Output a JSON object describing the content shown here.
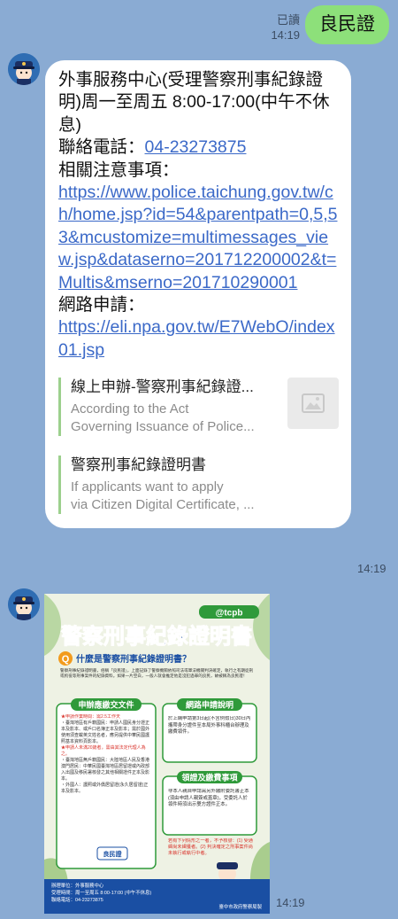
{
  "sent": {
    "read_label": "已讀",
    "time": "14:19",
    "text": "良民證"
  },
  "reply": {
    "line1": "外事服務中心(受理警察刑事紀錄證明)周一至周五 8:00-17:00(中午不休息)",
    "phone_label": "聯絡電話：",
    "phone": "04-23273875",
    "notes_label": "相關注意事項：",
    "notes_link": "https://www.police.taichung.gov.tw/ch/home.jsp?id=54&parentpath=0,5,53&mcustomize=multimessages_view.jsp&dataserno=201712200002&t=Multis&mserno=201710290001",
    "apply_label": "網路申請：",
    "apply_link": "https://eli.npa.gov.tw/E7WebO/index01.jsp",
    "card1": {
      "title": "線上申辦-警察刑事紀錄證...",
      "desc1": "According to the Act",
      "desc2": "Governing Issuance of Police..."
    },
    "card2": {
      "title": "警察刑事紀錄證明書",
      "desc1": "If applicants want to apply",
      "desc2": "via Citizen Digital Certificate, ..."
    },
    "time": "14:19"
  },
  "poster": {
    "handle": "@tcpb",
    "title": "警察刑事紀錄證明書",
    "question": "什麼是警察刑事紀錄證明書？",
    "intro": "警察刑事紀錄證明書，俗稱「良民證」，上面記錄了警察機關依照司法或軍法機關判決確定，執行之有期徒刑或拘役等刑事案件的紀錄資料。如果一片空白，一般人就會推定他是沒犯過罪的良民，故被稱為良民證！",
    "sec1_title": "申辦應繳交文件",
    "sec1_items": [
      "★申請作業時間：需2.5工作天",
      "・臺灣地區有戶籍國民：申請人國民身分證正本及影本、或戶口名簿正本及影本；需於國外使用須查載英文姓名者，應另提供中華民國護照基本資料頁影本。",
      "★申請人未滿20歲者，需由其法定代理人為之。",
      "・臺灣地區無戶籍國民：大陸地區人民及香港澳門居民：中華民國臺灣地區居留證或內政部入出國及移民署核發之其他相關證件正本及影本。",
      "・外國人：護照或外僑居留證(永久居留證)正本及影本。"
    ],
    "sec2_title": "網路申請說明",
    "sec2_text": "於上網申請第3日起(不含例假日)30日內攜帶身分證件至本局外事科櫃台辦理及繳費領件。",
    "sec3_title": "領證及繳費事項",
    "sec3_text": "非本人親自申請需另外繳附委託書正本(須由申請人親簽或蓋章)，受委託人於領件時須出示雙方證件正本。",
    "sec4_text": "若有下列情形之一者，不予核發：(1) 受通緝尚未緝獲者。(2) 判決確定之刑事案件尚未執行或執行中者。",
    "badge": "良民證",
    "footer_lines": [
      "辦理單位：外事服務中心",
      "受理時間：周一至周五 8:00-17:00 (中午不休息)",
      "聯絡電話：04-23273875"
    ],
    "footer_org": "臺中市政府警察局製",
    "time": "14:19"
  }
}
